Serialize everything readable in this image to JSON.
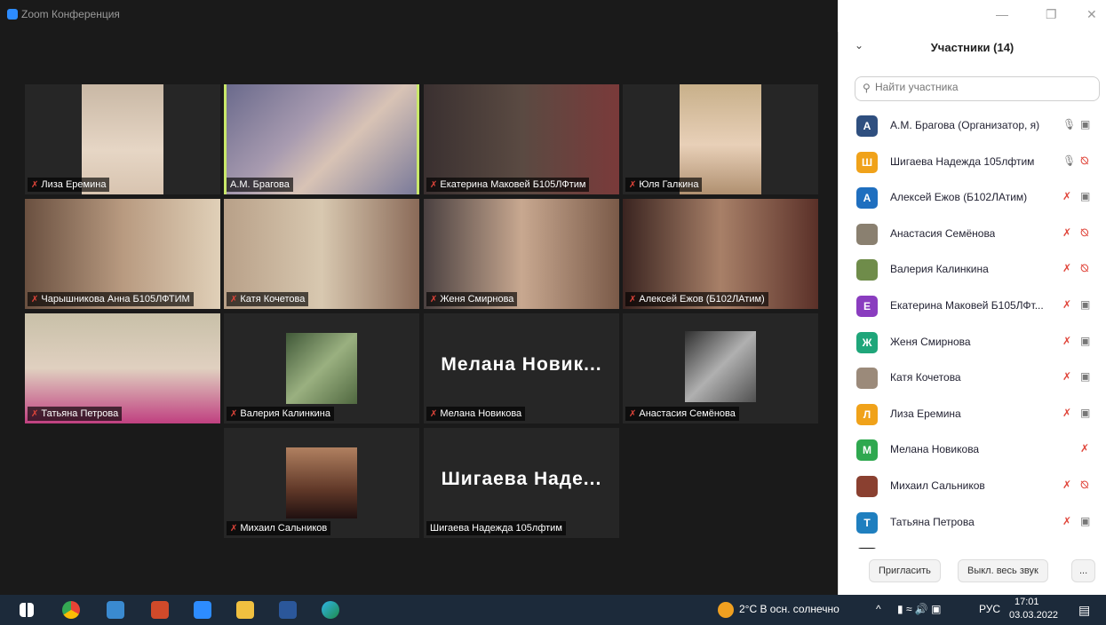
{
  "window": {
    "title": "Zoom Конференция",
    "minimize": "—",
    "maximize": "❐",
    "close": "✕"
  },
  "tiles": [
    {
      "name": "Лиза Еремина"
    },
    {
      "name": "А.М. Брагова"
    },
    {
      "name": "Екатерина Маковей Б105ЛФтим"
    },
    {
      "name": "Юля Галкина"
    },
    {
      "name": "Чарышникова Анна Б105ЛФТИМ"
    },
    {
      "name": "Катя Кочетова"
    },
    {
      "name": "Женя Смирнова"
    },
    {
      "name": "Алексей Ежов (Б102ЛАтим)"
    },
    {
      "name": "Татьяна Петрова"
    },
    {
      "name": "Валерия Калинкина"
    },
    {
      "name": "Мелана Новикова",
      "big": "Мелана  Новик..."
    },
    {
      "name": "Анастасия Семёнова"
    },
    {
      "name": "Михаил Сальников"
    },
    {
      "name": "Шигаева Надежда 105лфтим",
      "big": "Шигаева  Наде..."
    }
  ],
  "panel": {
    "title": "Участники (14)",
    "chevron": "⌄",
    "search_placeholder": "Найти участника",
    "participants": [
      {
        "initial": "А",
        "color": "#2f4f7f",
        "name": "А.М. Брагова (Организатор, я)"
      },
      {
        "initial": "Ш",
        "color": "#f0a21a",
        "name": "Шигаева Надежда 105лфтим"
      },
      {
        "initial": "А",
        "color": "#1f6fbf",
        "name": "Алексей Ежов (Б102ЛАтим)"
      },
      {
        "initial": "",
        "color": "#8a8070",
        "name": "Анастасия Семёнова"
      },
      {
        "initial": "",
        "color": "#6f8c4a",
        "name": "Валерия Калинкина"
      },
      {
        "initial": "Е",
        "color": "#8a3dbf",
        "name": "Екатерина Маковей Б105ЛФт..."
      },
      {
        "initial": "Ж",
        "color": "#1fa67a",
        "name": "Женя Смирнова"
      },
      {
        "initial": "",
        "color": "#9b8a7a",
        "name": "Катя Кочетова"
      },
      {
        "initial": "Л",
        "color": "#f0a21a",
        "name": "Лиза Еремина"
      },
      {
        "initial": "М",
        "color": "#2fa84f",
        "name": "Мелана Новикова"
      },
      {
        "initial": "",
        "color": "#8a4030",
        "name": "Михаил Сальников"
      },
      {
        "initial": "Т",
        "color": "#1f7fbf",
        "name": "Татьяна Петрова"
      }
    ],
    "invite": "Пригласить",
    "mute_all": "Выкл. весь звук",
    "more": "..."
  },
  "taskbar": {
    "weather": "2°C  В осн. солнечно",
    "lang": "РУС",
    "time": "17:01",
    "date": "03.03.2022"
  }
}
